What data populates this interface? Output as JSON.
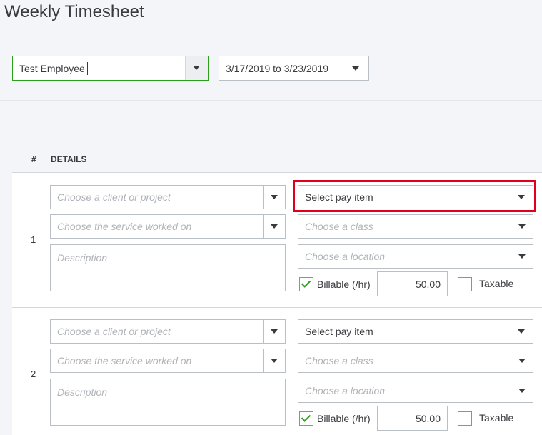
{
  "header": {
    "title": "Weekly Timesheet"
  },
  "filters": {
    "employee": "Test Employee",
    "date_range": "3/17/2019 to 3/23/2019"
  },
  "table": {
    "col_num": "#",
    "col_details": "DETAILS",
    "rows": [
      {
        "num": "1",
        "client_placeholder": "Choose a client or project",
        "service_placeholder": "Choose the service worked on",
        "description_placeholder": "Description",
        "pay_item": "Select pay item",
        "class_placeholder": "Choose a class",
        "location_placeholder": "Choose a location",
        "billable_label": "Billable (/hr)",
        "billable_checked": true,
        "rate": "50.00",
        "taxable_label": "Taxable",
        "taxable_checked": false
      },
      {
        "num": "2",
        "client_placeholder": "Choose a client or project",
        "service_placeholder": "Choose the service worked on",
        "description_placeholder": "Description",
        "pay_item": "Select pay item",
        "class_placeholder": "Choose a class",
        "location_placeholder": "Choose a location",
        "billable_label": "Billable (/hr)",
        "billable_checked": true,
        "rate": "50.00",
        "taxable_label": "Taxable",
        "taxable_checked": false
      }
    ]
  },
  "colors": {
    "accent_green": "#2ca01c",
    "highlight_red": "#e0001b"
  }
}
